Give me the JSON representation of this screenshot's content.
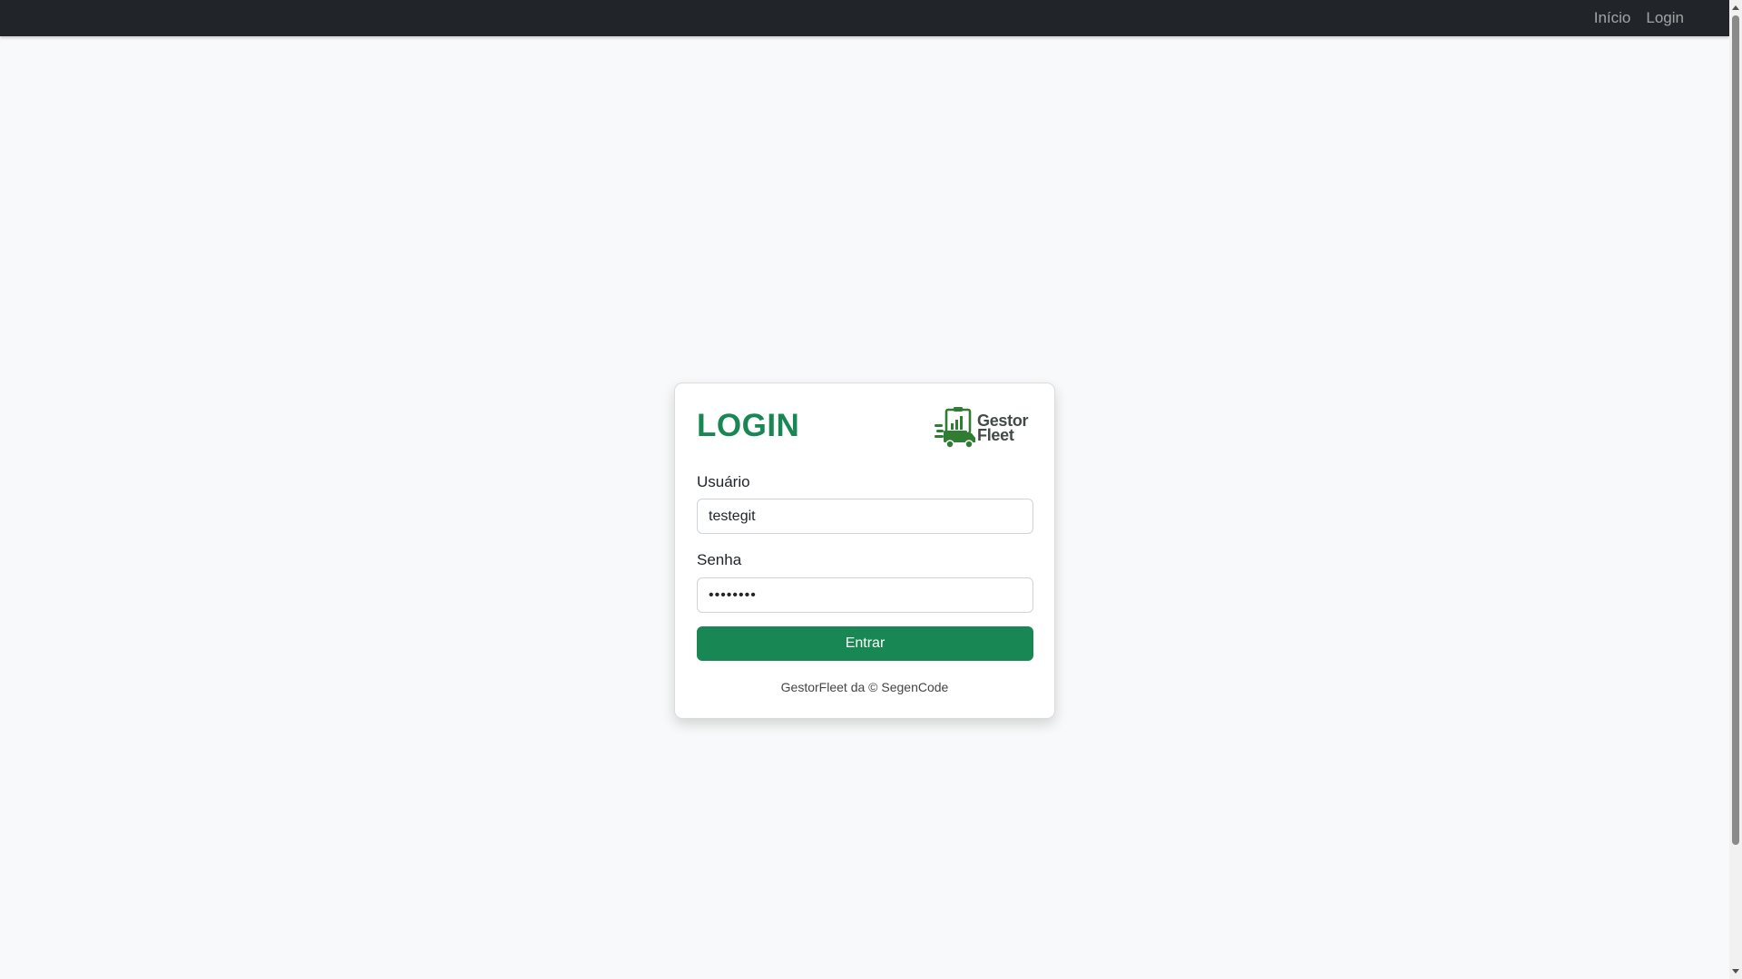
{
  "navbar": {
    "links": [
      {
        "label": "Início"
      },
      {
        "label": "Login"
      }
    ]
  },
  "login": {
    "title": "LOGIN",
    "logo": {
      "line1": "Gestor",
      "line2": "Fleet"
    },
    "username": {
      "label": "Usuário",
      "value": "testegit"
    },
    "password": {
      "label": "Senha",
      "value": "••••••••"
    },
    "submit_label": "Entrar",
    "footer": "GestorFleet da © SegenCode"
  },
  "colors": {
    "navbar_bg": "#212529",
    "accent": "#198754",
    "page_bg": "#f8f9fa"
  },
  "icons": [
    "truck-clipboard-logo-icon"
  ]
}
